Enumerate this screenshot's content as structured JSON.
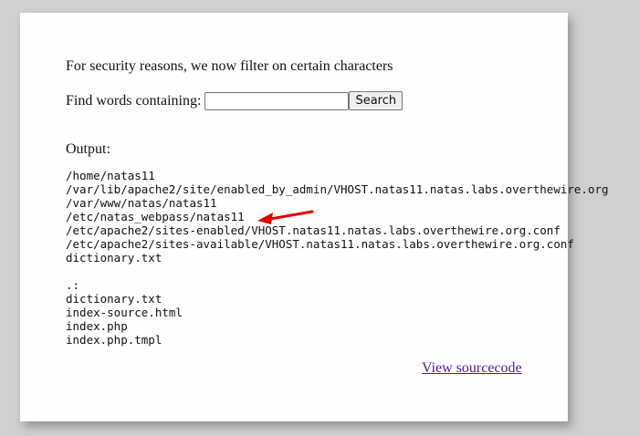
{
  "page": {
    "notice": "For security reasons, we now filter on certain characters",
    "search": {
      "label": "Find words containing:",
      "value": "",
      "placeholder": "",
      "button_label": "Search"
    },
    "output_label": "Output:",
    "find_results": [
      "/home/natas11",
      "/var/lib/apache2/site/enabled_by_admin/VHOST.natas11.natas.labs.overthewire.org",
      "/var/www/natas/natas11",
      "/etc/natas_webpass/natas11",
      "/etc/apache2/sites-enabled/VHOST.natas11.natas.labs.overthewire.org.conf",
      "/etc/apache2/sites-available/VHOST.natas11.natas.labs.overthewire.org.conf",
      "dictionary.txt"
    ],
    "ls_results": [
      ".:",
      "dictionary.txt",
      "index-source.html",
      "index.php",
      "index.php.tmpl"
    ],
    "source_link": "View sourcecode"
  },
  "annotation": {
    "arrow_color": "#e00000",
    "arrow_icon": "red-arrow-icon"
  },
  "colors": {
    "page_background": "#cfcfcf",
    "panel_background": "#fefefe",
    "link_color": "#551a8b"
  }
}
